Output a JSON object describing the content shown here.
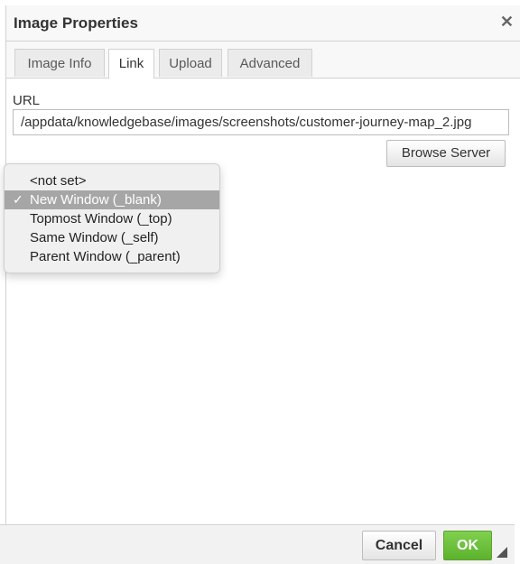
{
  "dialog": {
    "title": "Image Properties",
    "close_glyph": "✕",
    "tabs": [
      {
        "label": "Image Info"
      },
      {
        "label": "Link"
      },
      {
        "label": "Upload"
      },
      {
        "label": "Advanced"
      }
    ],
    "active_tab": "Link",
    "url_label": "URL",
    "url_value": "/appdata/knowledgebase/images/screenshots/customer-journey-map_2.jpg",
    "browse_label": "Browse Server",
    "target_menu": {
      "items": [
        {
          "label": "<not set>"
        },
        {
          "label": "New Window (_blank)",
          "check": "✓"
        },
        {
          "label": "Topmost Window (_top)"
        },
        {
          "label": "Same Window (_self)"
        },
        {
          "label": "Parent Window (_parent)"
        }
      ],
      "selected": "New Window (_blank)"
    },
    "footer": {
      "cancel_label": "Cancel",
      "ok_label": "OK"
    },
    "colors": {
      "ok_button": "#5cb22d",
      "menu_highlight": "#a6a6a6"
    }
  }
}
